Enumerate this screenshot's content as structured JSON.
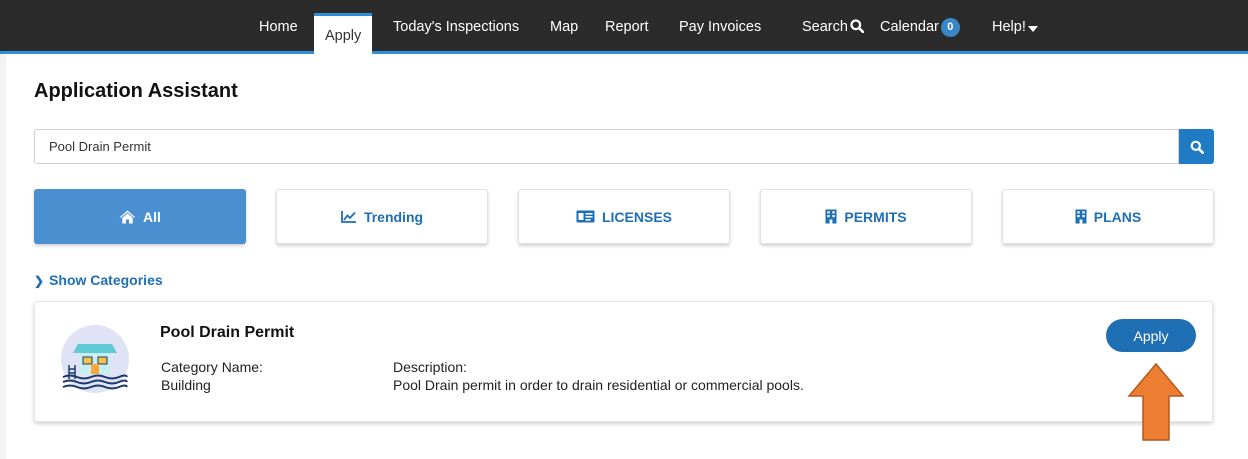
{
  "nav": {
    "items": [
      {
        "label": "Home"
      },
      {
        "label": "Apply"
      },
      {
        "label": "Today's Inspections"
      },
      {
        "label": "Map"
      },
      {
        "label": "Report"
      },
      {
        "label": "Pay Invoices"
      },
      {
        "label": "Search"
      },
      {
        "label": "Calendar"
      },
      {
        "label": "Help!"
      }
    ],
    "active": "Apply",
    "calendar_count": "0",
    "accent_color": "#2f8fd9",
    "bar_color": "#2b2b2b"
  },
  "page": {
    "title": "Application Assistant"
  },
  "search": {
    "value": "Pool Drain Permit",
    "button_icon": "search-icon"
  },
  "filters": [
    {
      "label": "All",
      "icon": "home-icon",
      "active": true
    },
    {
      "label": "Trending",
      "icon": "trending-chart-icon",
      "active": false
    },
    {
      "label": "LICENSES",
      "icon": "id-card-icon",
      "active": false
    },
    {
      "label": "PERMITS",
      "icon": "building-icon",
      "active": false
    },
    {
      "label": "PLANS",
      "icon": "building-icon",
      "active": false
    }
  ],
  "show_categories": "Show Categories",
  "result": {
    "title": "Pool Drain Permit",
    "category_label": "Category Name:",
    "category_value": "Building",
    "description_label": "Description:",
    "description_value": "Pool Drain permit in order to drain residential or commercial pools.",
    "apply_label": "Apply",
    "icon": "pool-house-icon"
  },
  "annotation": {
    "arrow_color": "#ed7d31",
    "icon": "up-arrow-icon"
  }
}
